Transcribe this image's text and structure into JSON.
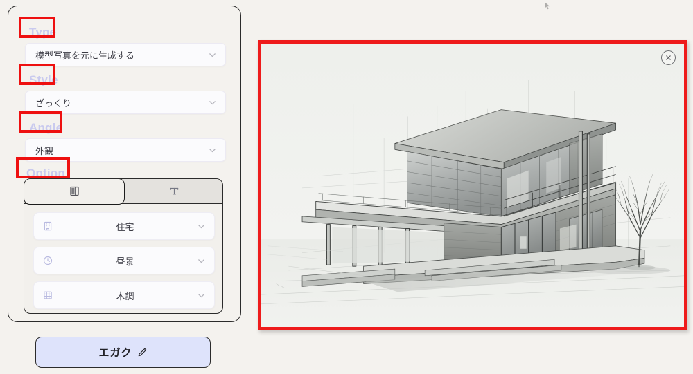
{
  "app": {
    "background_color": "#f4f2ee",
    "accent_color": "#dee3fb",
    "annotation_color": "#ee1010",
    "label_color": "#c9caee"
  },
  "panel": {
    "fields": [
      {
        "label": "Type",
        "icon": "chevron-down-icon",
        "value": "模型写真を元に生成する",
        "annotated": true
      },
      {
        "label": "Style",
        "icon": "chevron-down-icon",
        "value": "ざっくり",
        "annotated": true
      },
      {
        "label": "Angle",
        "icon": "chevron-down-icon",
        "value": "外観",
        "annotated": true
      }
    ],
    "option": {
      "label": "Option",
      "annotated": true,
      "tabs": [
        {
          "icon": "panel-layout-icon",
          "label": "",
          "active": true
        },
        {
          "icon": "text-type-icon",
          "label": "",
          "active": false
        }
      ],
      "rows": [
        {
          "icon": "building-icon",
          "value": "住宅",
          "chevron": "chevron-down-icon"
        },
        {
          "icon": "clock-icon",
          "value": "昼景",
          "chevron": "chevron-down-icon"
        },
        {
          "icon": "grid-texture-icon",
          "value": "木調",
          "chevron": "chevron-down-icon"
        }
      ]
    },
    "submit": {
      "label": "エガク",
      "icon": "pencil-icon"
    }
  },
  "preview": {
    "annotated": true,
    "close_icon": "close-circle-icon",
    "image_alt": "建築パース 鉛筆スケッチ 二階建て住宅 外観"
  }
}
